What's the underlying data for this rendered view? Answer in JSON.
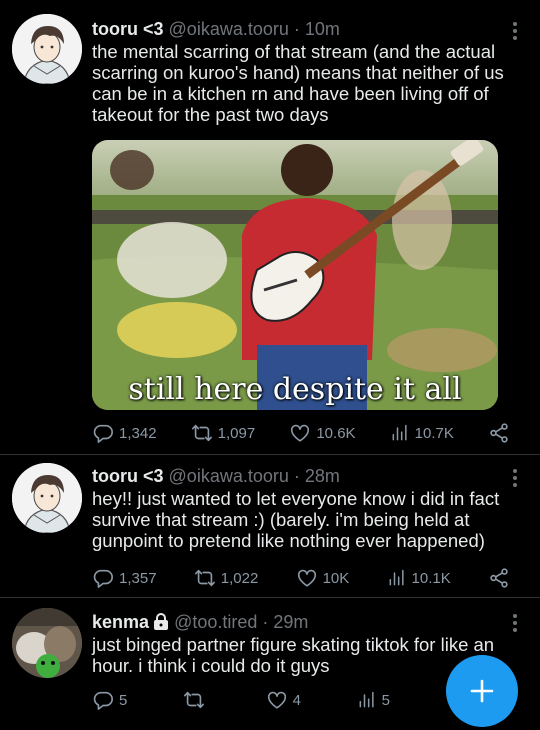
{
  "tweets": [
    {
      "name": "tooru <3",
      "handle": "@oikawa.tooru",
      "time": "10m",
      "text": "the mental scarring of that stream (and the actual scarring on kuroo's hand) means that neither of us can be in a kitchen rn and have been living off of takeout for the past two days",
      "image_caption": "still here despite it all",
      "replies": "1,342",
      "retweets": "1,097",
      "likes": "10.6K",
      "views": "10.7K"
    },
    {
      "name": "tooru <3",
      "handle": "@oikawa.tooru",
      "time": "28m",
      "text": "hey!! just wanted to let everyone know i did in fact survive that stream :) (barely. i'm being held at gunpoint to pretend like nothing ever happened)",
      "replies": "1,357",
      "retweets": "1,022",
      "likes": "10K",
      "views": "10.1K"
    },
    {
      "name": "kenma",
      "handle": "@too.tired",
      "time": "29m",
      "text": "just binged partner figure skating tiktok for like an hour. i think i could do it guys",
      "replies": "5",
      "retweets": "",
      "likes": "4",
      "views": "5"
    }
  ],
  "separator": " · ",
  "icons": {
    "reply": "reply-icon",
    "retweet": "retweet-icon",
    "like": "heart-icon",
    "views": "views-icon",
    "share": "share-icon",
    "lock": "lock-icon",
    "compose": "plus-icon",
    "menu": "more-vertical-icon"
  },
  "colors": {
    "background": "#000000",
    "text": "#e7e9ea",
    "secondary": "#71767b",
    "accent": "#1d9bf0",
    "divider": "#2f3336"
  }
}
